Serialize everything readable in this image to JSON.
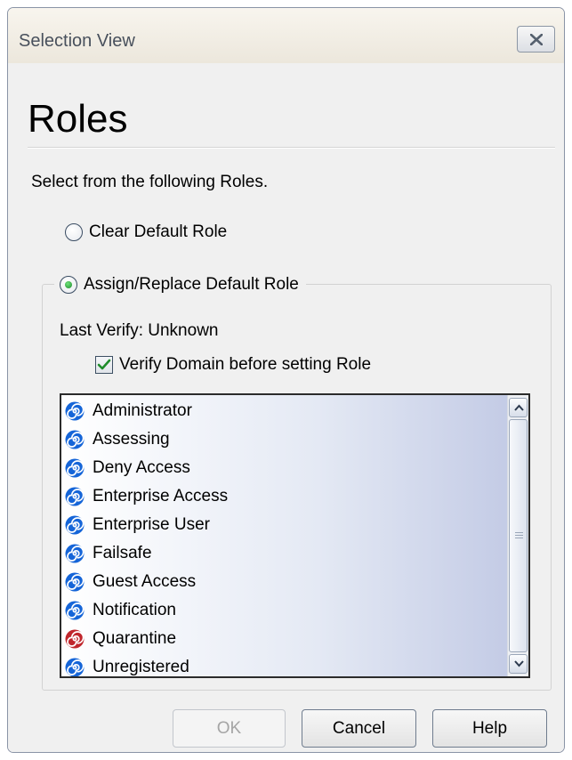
{
  "window": {
    "title": "Selection View"
  },
  "heading": "Roles",
  "instruction": "Select from the following Roles.",
  "options": {
    "clear_default": {
      "label": "Clear Default Role",
      "selected": false
    },
    "assign_replace": {
      "label": "Assign/Replace Default Role",
      "selected": true
    }
  },
  "last_verify": "Last Verify: Unknown",
  "verify_domain": {
    "label": "Verify Domain before setting Role",
    "checked": true
  },
  "roles": [
    {
      "label": "Administrator",
      "icon": "role-icon-blue"
    },
    {
      "label": "Assessing",
      "icon": "role-icon-blue"
    },
    {
      "label": "Deny Access",
      "icon": "role-icon-blue"
    },
    {
      "label": "Enterprise Access",
      "icon": "role-icon-blue"
    },
    {
      "label": "Enterprise User",
      "icon": "role-icon-blue"
    },
    {
      "label": "Failsafe",
      "icon": "role-icon-blue"
    },
    {
      "label": "Guest Access",
      "icon": "role-icon-blue"
    },
    {
      "label": "Notification",
      "icon": "role-icon-blue"
    },
    {
      "label": "Quarantine",
      "icon": "role-icon-red"
    },
    {
      "label": "Unregistered",
      "icon": "role-icon-blue"
    }
  ],
  "buttons": {
    "ok": "OK",
    "cancel": "Cancel",
    "help": "Help"
  },
  "colors": {
    "role_blue": "#1565d8",
    "role_red": "#c0262c"
  }
}
